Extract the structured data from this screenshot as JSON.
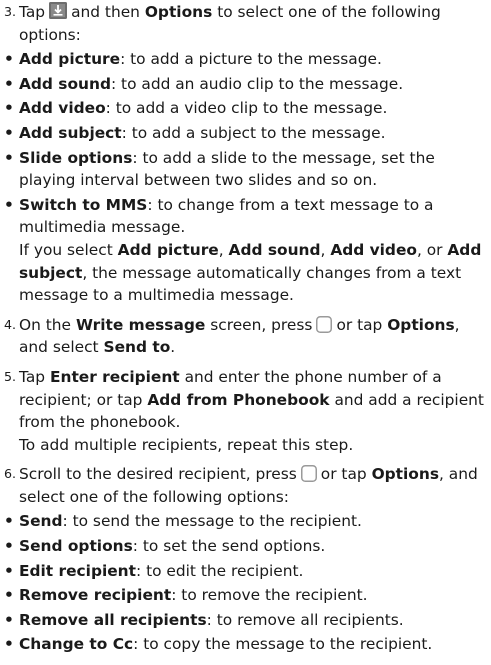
{
  "steps": {
    "s3": {
      "num": "3.",
      "pre": "Tap",
      "icon": "save-icon",
      "mid": "and then",
      "opt": "Options",
      "post": "to select one of the following options:"
    },
    "b3": [
      {
        "bold": "Add picture",
        "text": ": to add a picture to the message."
      },
      {
        "bold": "Add sound",
        "text": ": to add an audio clip to the message."
      },
      {
        "bold": "Add video",
        "text": ": to add a video clip to the message."
      },
      {
        "bold": "Add subject",
        "text": ": to add a subject to the message."
      },
      {
        "bold": "Slide options",
        "text": ": to add a slide to the message, set the playing interval between two slides and so on."
      },
      {
        "bold": "Switch to MMS",
        "text": ": to change from a text message to a multimedia message."
      }
    ],
    "mms_note": {
      "t1": "If you select",
      "b1": "Add picture",
      "t2": ",",
      "b2": "Add sound",
      "t3": ",",
      "b3": "Add video",
      "t4": ", or",
      "b4": "Add subject",
      "t5": ", the message automatically changes from a text message to a multimedia message."
    },
    "s4": {
      "num": "4.",
      "t1": "On the",
      "b1": "Write message",
      "t2": "screen, press",
      "icon": "softkey-icon",
      "t3": "or tap",
      "b2": "Options",
      "t4": ", and select",
      "b3": "Send to",
      "t5": "."
    },
    "s5": {
      "num": "5.",
      "t1": "Tap",
      "b1": "Enter recipient",
      "t2": "and enter the phone number of a recipient; or tap",
      "b2": "Add from Phonebook",
      "t3": "and add a recipient from the phonebook.",
      "note": "To add multiple recipients, repeat this step."
    },
    "s6": {
      "num": "6.",
      "t1": "Scroll to the desired recipient, press",
      "icon": "softkey-icon",
      "t2": "or tap",
      "b1": "Options",
      "t3": ", and select one of the following options:"
    },
    "b6": [
      {
        "bold": "Send",
        "text": ": to send the message to the recipient."
      },
      {
        "bold": "Send options",
        "text": ": to set the send options."
      },
      {
        "bold": "Edit recipient",
        "text": ": to edit the recipient."
      },
      {
        "bold": "Remove recipient",
        "text": ": to remove the recipient."
      },
      {
        "bold": "Remove all recipients",
        "text": ": to remove all recipients."
      },
      {
        "bold": "Change to Cc",
        "text": ": to copy the message to the recipient."
      }
    ],
    "bullet_char": "•"
  }
}
